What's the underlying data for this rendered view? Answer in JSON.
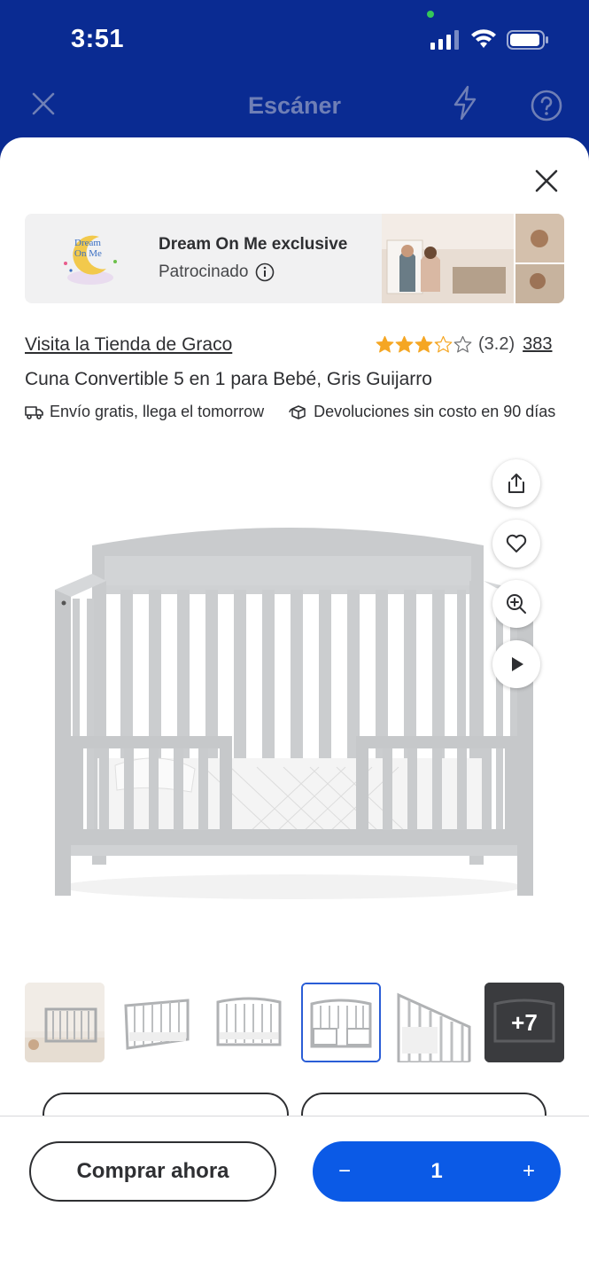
{
  "status_bar": {
    "time": "3:51"
  },
  "scanner": {
    "title": "Escáner"
  },
  "ad": {
    "brand": "Dream On Me exclusive",
    "sponsored_label": "Patrocinado",
    "logo_text_line1": "Dream",
    "logo_text_line2": "On Me"
  },
  "product": {
    "store_link": "Visita la Tienda de Graco",
    "rating_value": "(3.2)",
    "rating_stars": 3.2,
    "review_count": "383",
    "title": "Cuna Convertible 5 en 1 para Bebé, Gris Guijarro",
    "shipping": "Envío gratis, llega el tomorrow",
    "returns": "Devoluciones sin costo en 90 días"
  },
  "thumbnails": {
    "count": 6,
    "selected_index": 3,
    "more_label": "+7"
  },
  "bottom_bar": {
    "buy_now_label": "Comprar ahora",
    "quantity": "1",
    "minus": "−",
    "plus": "+"
  },
  "colors": {
    "brand_blue": "#0a2b92",
    "action_blue": "#0b5ae6",
    "star": "#f5a623",
    "text": "#2e2f32"
  }
}
